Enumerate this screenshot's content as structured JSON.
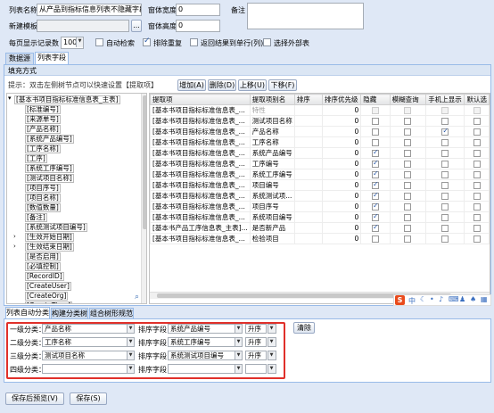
{
  "form": {
    "list_name_label": "列表名称",
    "list_name_value": "从产品到指标信息列表不隐藏字段",
    "new_template_label": "新建模板",
    "new_template_value": "",
    "window_width_label": "窗体宽度",
    "window_width_value": "0",
    "window_height_label": "窗体高度",
    "window_height_value": "0",
    "remark_label": "备注",
    "remark_value": "",
    "page_size_label": "每页显示记录数",
    "page_size_value": "100",
    "browse_button": "...",
    "auto_search": "自动检索",
    "dedupe": "排除重复",
    "return_single_row": "返回结果到单行(列)",
    "select_external_table": "选择外部表"
  },
  "tabs": [
    "数据源",
    "列表字段"
  ],
  "fill_mode_label": "填充方式",
  "hint_text": "提示：双击左侧树节点可以快速设置【提取项】",
  "toolbar": {
    "add": "增加(A)",
    "delete": "删除(D)",
    "move_up": "上移(U)",
    "move_down": "下移(F)"
  },
  "tree": {
    "root": "[基本书项目指标标准信息表_主表]",
    "items": [
      "[标准编号]",
      "[来源单号]",
      "[产品名称]",
      "[系统产品编号]",
      "[工序名称]",
      "[工序]",
      "[系统工序编号]",
      "[测试项目名称]",
      "[项目序号]",
      "[项目名称]",
      "[数值数量]",
      "[备注]",
      "[系统测试项目编号]",
      "[生效开始日期]",
      "[生效结束日期]",
      "[是否启用]",
      "[必填控制]",
      "[RecordID]",
      "[CreateUser]",
      "[CreateOrg]",
      "[CreateTime]"
    ]
  },
  "grid": {
    "columns": [
      "提取项",
      "提取项别名",
      "排序",
      "排序优先级",
      "隐藏",
      "模糊查询",
      "手机上显示",
      "默认选"
    ],
    "rows": [
      {
        "field": "[基本书项目指标标准信息表_...",
        "alias": "特性",
        "sort": "",
        "priority": "0",
        "hide": false,
        "fuzzy": false,
        "mobile": false,
        "dis": true
      },
      {
        "field": "[基本书项目指标标准信息表_...",
        "alias": "测试项目名称",
        "sort": "",
        "priority": "0",
        "hide": false,
        "fuzzy": false,
        "mobile": false
      },
      {
        "field": "[基本书项目指标标准信息表_...",
        "alias": "产品名称",
        "sort": "",
        "priority": "0",
        "hide": false,
        "fuzzy": false,
        "mobile": true
      },
      {
        "field": "[基本书项目指标标准信息表_...",
        "alias": "工序名称",
        "sort": "",
        "priority": "0",
        "hide": false,
        "fuzzy": false,
        "mobile": false
      },
      {
        "field": "[基本书项目指标标准信息表_...",
        "alias": "系统产品编号",
        "sort": "",
        "priority": "0",
        "hide": true,
        "fuzzy": false,
        "mobile": false
      },
      {
        "field": "[基本书项目指标标准信息表_...",
        "alias": "工序编号",
        "sort": "",
        "priority": "0",
        "hide": true,
        "fuzzy": false,
        "mobile": false
      },
      {
        "field": "[基本书项目指标标准信息表_...",
        "alias": "系统工序编号",
        "sort": "",
        "priority": "0",
        "hide": true,
        "fuzzy": false,
        "mobile": false
      },
      {
        "field": "[基本书项目指标标准信息表_...",
        "alias": "项目编号",
        "sort": "",
        "priority": "0",
        "hide": true,
        "fuzzy": false,
        "mobile": false
      },
      {
        "field": "[基本书项目指标标准信息表_...",
        "alias": "系统测试项...",
        "sort": "",
        "priority": "0",
        "hide": true,
        "fuzzy": false,
        "mobile": false
      },
      {
        "field": "[基本书项目指标标准信息表_...",
        "alias": "项目序号",
        "sort": "",
        "priority": "0",
        "hide": true,
        "fuzzy": false,
        "mobile": false
      },
      {
        "field": "[基本书项目指标标准信息表_...",
        "alias": "系统项目编号",
        "sort": "",
        "priority": "0",
        "hide": true,
        "fuzzy": false,
        "mobile": false
      },
      {
        "field": "[基本书产品工序信息表_主表]...",
        "alias": "是否新产品",
        "sort": "",
        "priority": "0",
        "hide": true,
        "fuzzy": false,
        "mobile": false
      },
      {
        "field": "[基本书项目指标标准信息表_...",
        "alias": "检验项目",
        "sort": "",
        "priority": "0",
        "hide": false,
        "fuzzy": false,
        "mobile": false
      }
    ]
  },
  "ime_toolbar": {
    "s": "S",
    "text": "中",
    "icons": [
      "moon-icon",
      "dot-icon",
      "mic-icon",
      "keyboard-icon",
      "person-icon",
      "shirt-icon",
      "grid-icon"
    ]
  },
  "bottom_tabs": [
    "列表自动分类",
    "构建分类树",
    "组合树形规范"
  ],
  "classify": {
    "levels": [
      {
        "label": "一级分类：",
        "field": "产品名称",
        "sort_label": "排序字段：",
        "sort_field": "系统产品编号",
        "order": "升序"
      },
      {
        "label": "二级分类：",
        "field": "工序名称",
        "sort_label": "排序字段：",
        "sort_field": "系统工序编号",
        "order": "升序"
      },
      {
        "label": "三级分类：",
        "field": "测试项目名称",
        "sort_label": "排序字段：",
        "sort_field": "系统测试项目编号",
        "order": "升序"
      },
      {
        "label": "四级分类：",
        "field": "",
        "sort_label": "排序字段：",
        "sort_field": "",
        "order": ""
      }
    ],
    "clear_button": "清除"
  },
  "footer": {
    "save_preview": "保存后预览(V)",
    "save": "保存(S)"
  },
  "colors": {
    "highlight_border": "#e0302a",
    "accent": "#99bbe8",
    "background": "#dfe8f6"
  }
}
